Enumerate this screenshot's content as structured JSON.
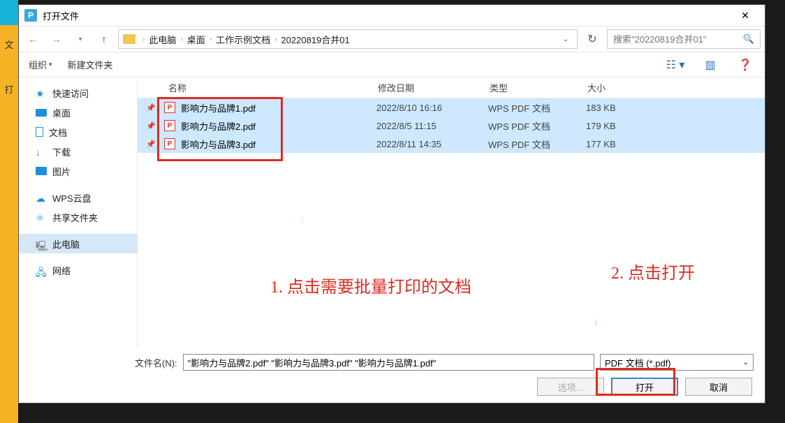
{
  "title": "打开文件",
  "breadcrumbs": [
    "此电脑",
    "桌面",
    "工作示例文档",
    "20220819合并01"
  ],
  "search_placeholder": "搜索\"20220819合并01\"",
  "toolbar": {
    "organize": "组织",
    "newfolder": "新建文件夹"
  },
  "sidebar": {
    "quick": "快速访问",
    "desktop": "桌面",
    "docs": "文档",
    "downloads": "下载",
    "pictures": "图片",
    "wps": "WPS云盘",
    "share": "共享文件夹",
    "thispc": "此电脑",
    "network": "网络"
  },
  "columns": {
    "name": "名称",
    "date": "修改日期",
    "type": "类型",
    "size": "大小"
  },
  "files": [
    {
      "name": "影响力与品牌1.pdf",
      "date": "2022/8/10 16:16",
      "type": "WPS PDF 文档",
      "size": "183 KB"
    },
    {
      "name": "影响力与品牌2.pdf",
      "date": "2022/8/5 11:15",
      "type": "WPS PDF 文档",
      "size": "179 KB"
    },
    {
      "name": "影响力与品牌3.pdf",
      "date": "2022/8/11 14:35",
      "type": "WPS PDF 文档",
      "size": "177 KB"
    }
  ],
  "filename_label": "文件名(N):",
  "filename_value": "\"影响力与品牌2.pdf\" \"影响力与品牌3.pdf\" \"影响力与品牌1.pdf\"",
  "filetype": "PDF 文档 (*.pdf)",
  "buttons": {
    "options": "选项...",
    "open": "打开",
    "cancel": "取消"
  },
  "annotations": {
    "a1": "1. 点击需要批量打印的文档",
    "a2": "2. 点击打开"
  },
  "leftstrip": {
    "t1": "文",
    "t2": "打"
  }
}
